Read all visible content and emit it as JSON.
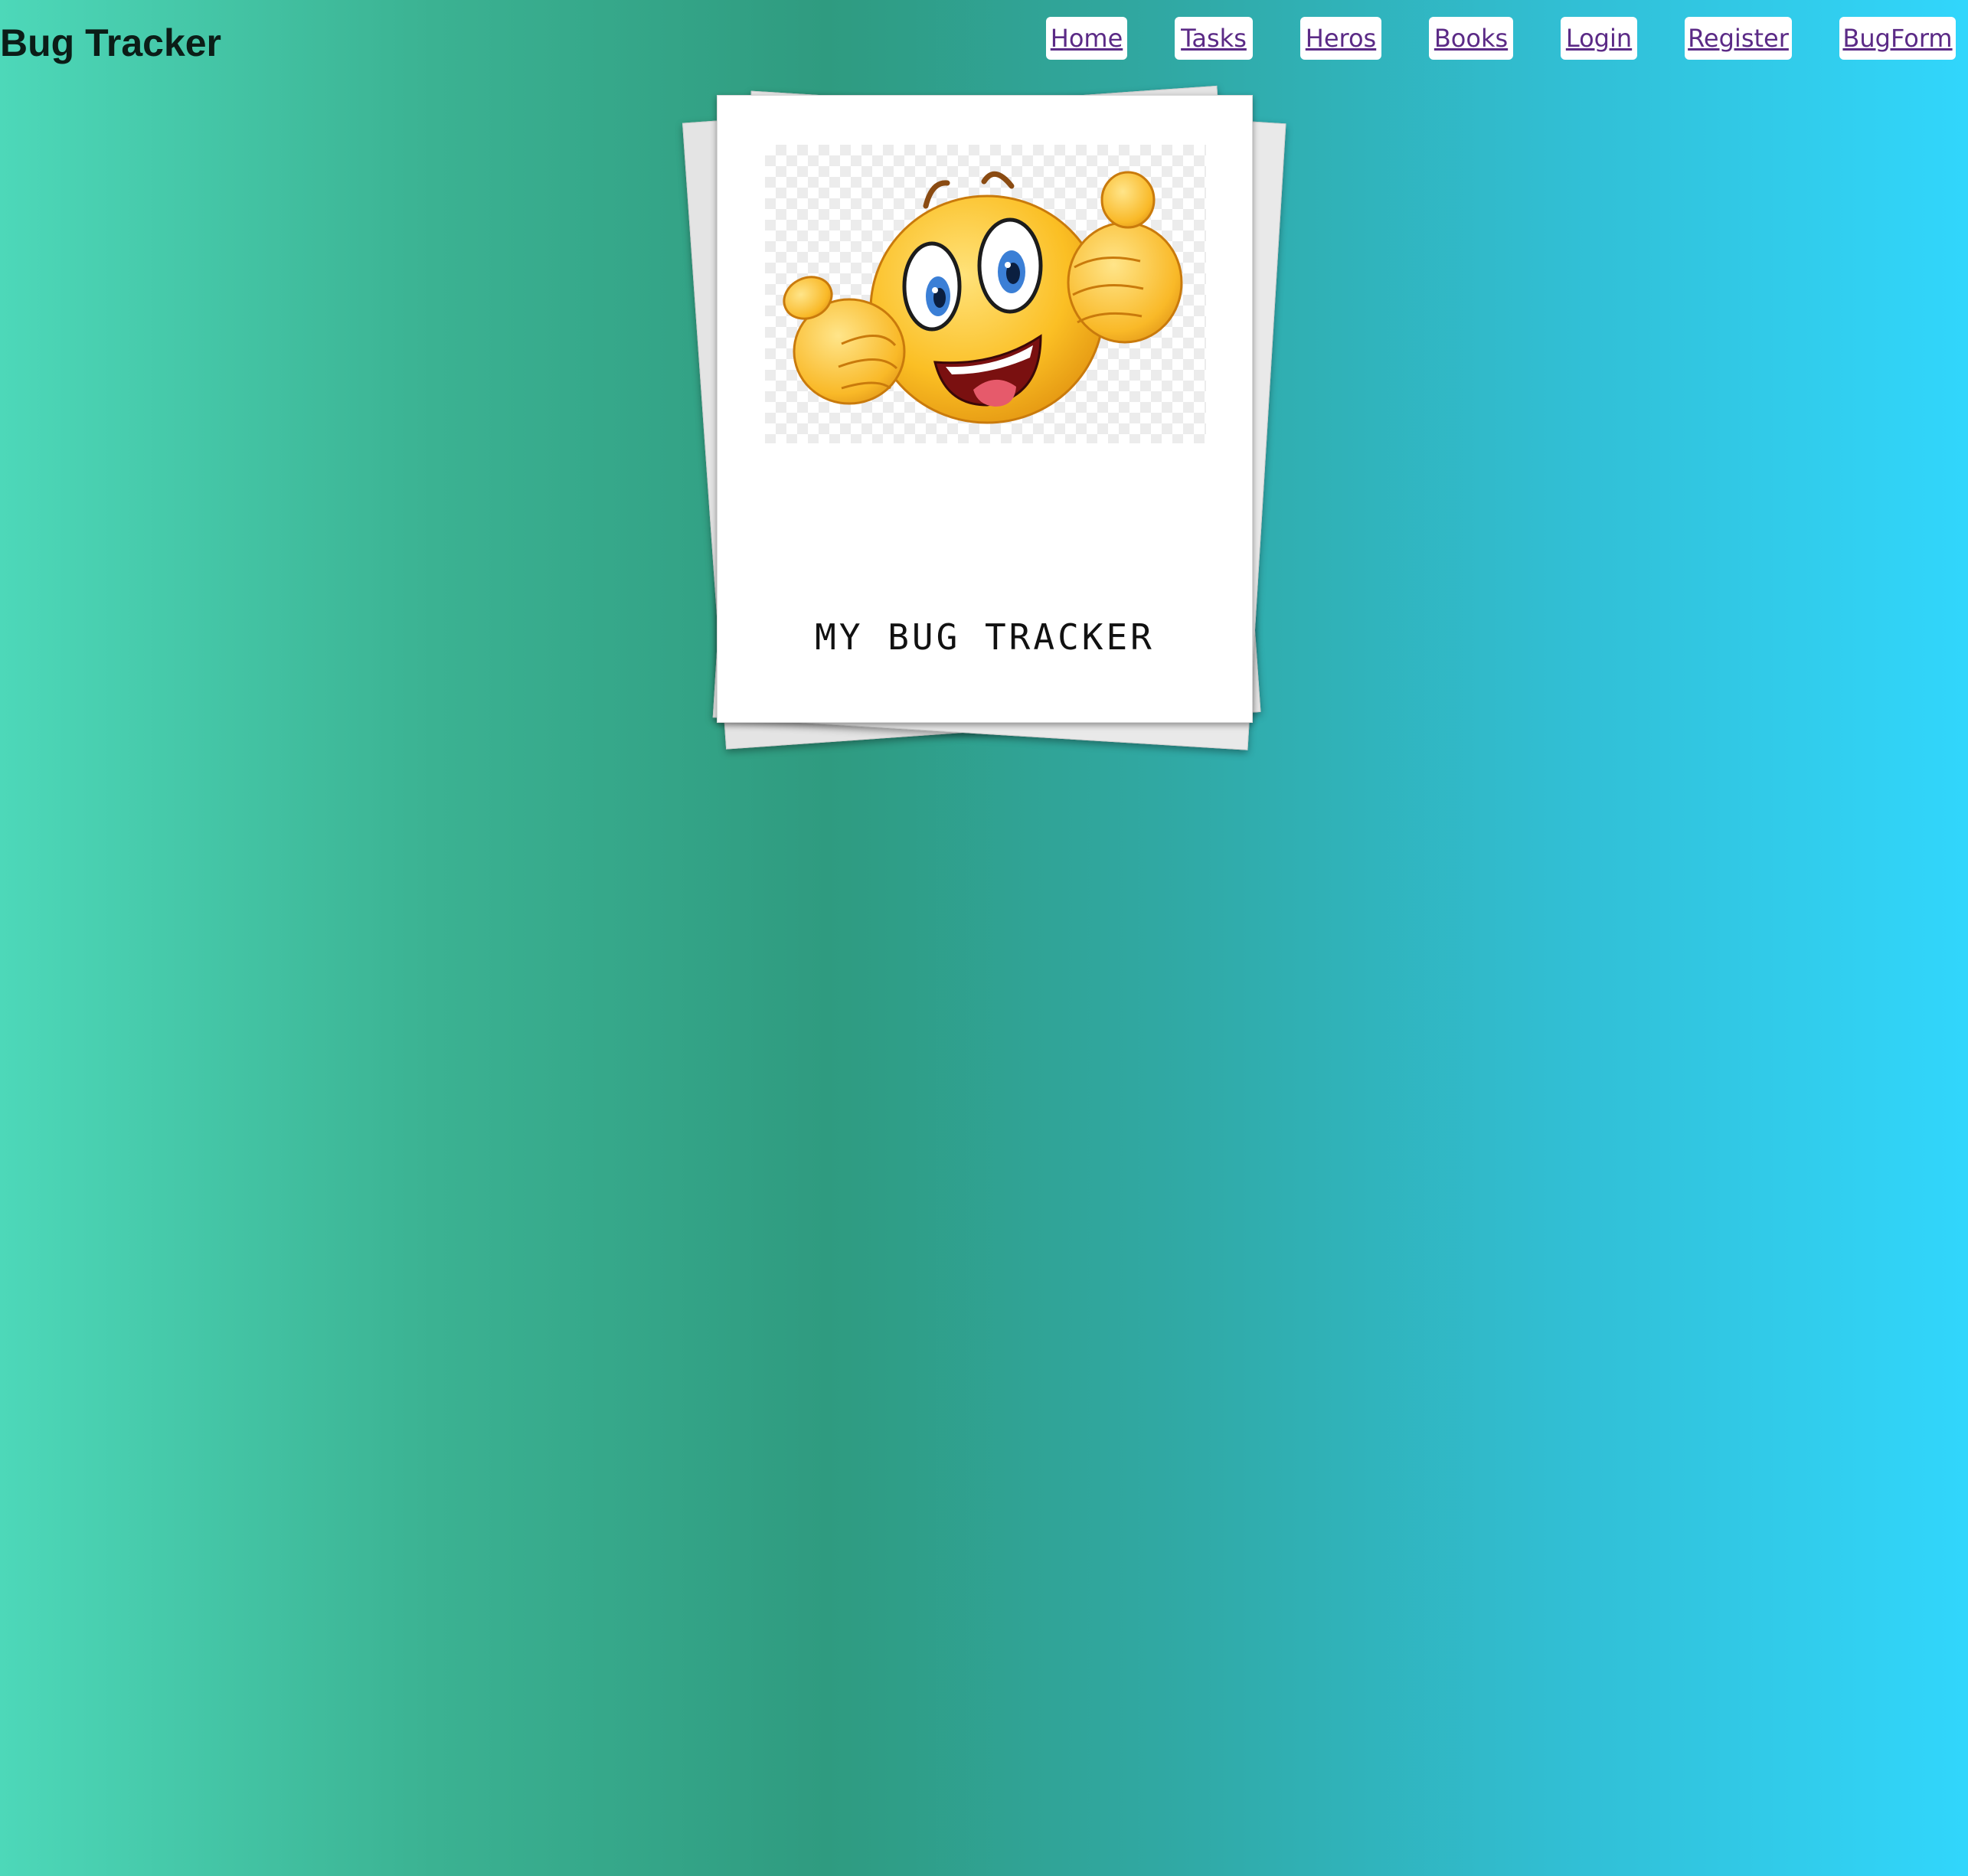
{
  "header": {
    "app_title": "Bug Tracker"
  },
  "nav": {
    "items": [
      {
        "label": "Home"
      },
      {
        "label": "Tasks"
      },
      {
        "label": "Heros"
      },
      {
        "label": "Books"
      },
      {
        "label": "Login"
      },
      {
        "label": "Register"
      },
      {
        "label": "BugForm"
      }
    ]
  },
  "card": {
    "image": "thumbs-up-smiley-emoji",
    "caption": "MY BUG TRACKER"
  },
  "colors": {
    "background_gradient": [
      "#4dd8b9",
      "#2f9b80",
      "#31d6fc"
    ],
    "nav_link": "#5b2a86",
    "nav_button_bg": "#ffffff",
    "card_bg": "#ffffff"
  }
}
